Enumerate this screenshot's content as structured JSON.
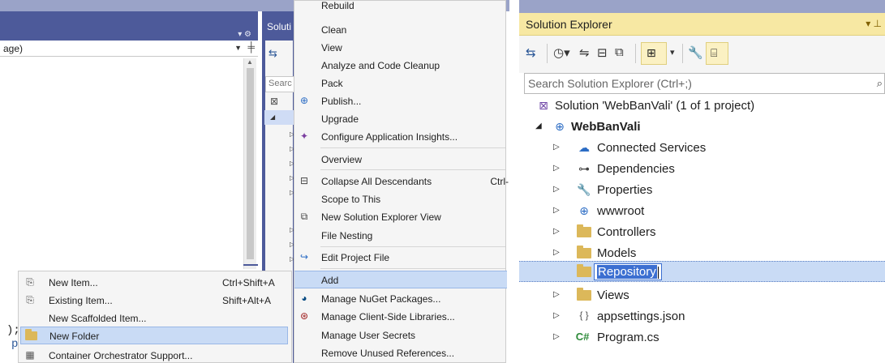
{
  "editor": {
    "dropdown_value": "age)",
    "code_fragment_1": ");",
    "code_fragment_2": "p"
  },
  "solution_strip": {
    "title": "Soluti",
    "search_placeholder": "Searc"
  },
  "context_menu": {
    "items": [
      {
        "label": "Rebuild",
        "icon": "",
        "shortcut": ""
      },
      {
        "label": "Clean",
        "icon": "",
        "shortcut": ""
      },
      {
        "label": "View",
        "icon": "",
        "shortcut": ""
      },
      {
        "label": "Analyze and Code Cleanup",
        "icon": "",
        "shortcut": ""
      },
      {
        "label": "Pack",
        "icon": "",
        "shortcut": ""
      },
      {
        "label": "Publish...",
        "icon": "publish-icon",
        "shortcut": ""
      },
      {
        "label": "Upgrade",
        "icon": "",
        "shortcut": ""
      },
      {
        "label": "Configure Application Insights...",
        "icon": "app-insights-icon",
        "shortcut": ""
      },
      {
        "label": "Overview",
        "icon": "",
        "shortcut": ""
      },
      {
        "label": "Collapse All Descendants",
        "icon": "collapse-icon",
        "shortcut": "Ctrl-"
      },
      {
        "label": "Scope to This",
        "icon": "",
        "shortcut": ""
      },
      {
        "label": "New Solution Explorer View",
        "icon": "new-view-icon",
        "shortcut": ""
      },
      {
        "label": "File Nesting",
        "icon": "",
        "shortcut": ""
      },
      {
        "label": "Edit Project File",
        "icon": "edit-project-icon",
        "shortcut": ""
      },
      {
        "label": "Add",
        "icon": "",
        "shortcut": "",
        "highlighted": true
      },
      {
        "label": "Manage NuGet Packages...",
        "icon": "nuget-icon",
        "shortcut": ""
      },
      {
        "label": "Manage Client-Side Libraries...",
        "icon": "client-libraries-icon",
        "shortcut": ""
      },
      {
        "label": "Manage User Secrets",
        "icon": "",
        "shortcut": ""
      },
      {
        "label": "Remove Unused References...",
        "icon": "",
        "shortcut": ""
      }
    ]
  },
  "add_submenu": {
    "items": [
      {
        "label": "New Item...",
        "shortcut": "Ctrl+Shift+A",
        "icon": "new-item-icon"
      },
      {
        "label": "Existing Item...",
        "shortcut": "Shift+Alt+A",
        "icon": "existing-item-icon"
      },
      {
        "label": "New Scaffolded Item...",
        "shortcut": "",
        "icon": ""
      },
      {
        "label": "New Folder",
        "shortcut": "",
        "icon": "new-folder-icon",
        "highlighted": true
      },
      {
        "label": "Container Orchestrator Support...",
        "shortcut": "",
        "icon": "container-icon"
      }
    ]
  },
  "solution_explorer": {
    "title": "Solution Explorer",
    "search_placeholder": "Search Solution Explorer (Ctrl+;)",
    "tree": {
      "solution": "Solution 'WebBanVali' (1 of 1 project)",
      "project": "WebBanVali",
      "children": [
        {
          "label": "Connected Services",
          "icon": "connected-services-icon"
        },
        {
          "label": "Dependencies",
          "icon": "dependencies-icon"
        },
        {
          "label": "Properties",
          "icon": "properties-icon"
        },
        {
          "label": "wwwroot",
          "icon": "globe-icon"
        },
        {
          "label": "Controllers",
          "icon": "folder-icon"
        },
        {
          "label": "Models",
          "icon": "folder-icon"
        },
        {
          "label": "Repository",
          "icon": "folder-icon",
          "renaming": true
        },
        {
          "label": "Views",
          "icon": "folder-icon"
        },
        {
          "label": "appsettings.json",
          "icon": "json-file-icon"
        },
        {
          "label": "Program.cs",
          "icon": "csharp-file-icon"
        }
      ]
    }
  },
  "colors": {
    "vs_header": "#4d5a9a",
    "selection": "#c9dbf5",
    "active_title": "#f7e8a3",
    "folder": "#dcb85a"
  }
}
